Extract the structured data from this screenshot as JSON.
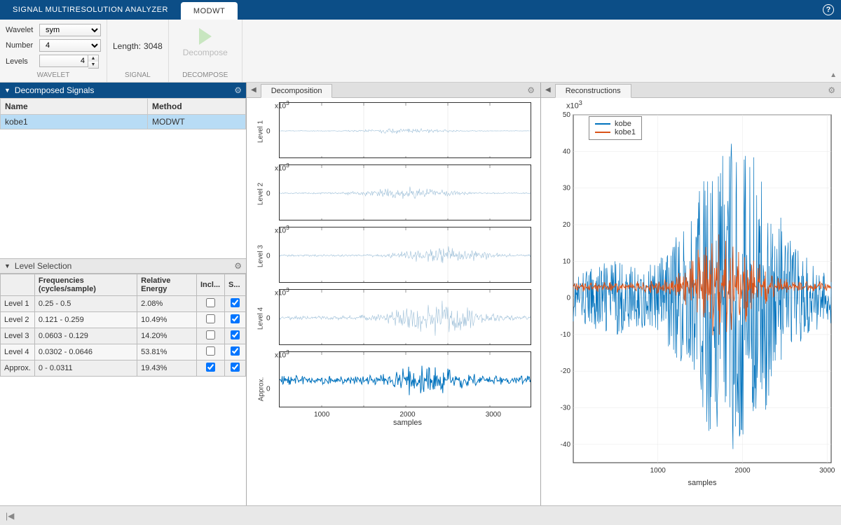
{
  "titlebar": {
    "app_title": "SIGNAL MULTIRESOLUTION ANALYZER",
    "active_tab": "MODWT"
  },
  "toolstrip": {
    "wavelet": {
      "label": "Wavelet",
      "value": "sym",
      "group": "WAVELET"
    },
    "number": {
      "label": "Number",
      "value": "4"
    },
    "levels": {
      "label": "Levels",
      "value": "4"
    },
    "signal": {
      "length_label": "Length:",
      "length_value": "3048",
      "group": "SIGNAL"
    },
    "decompose": {
      "label": "Decompose",
      "group": "DECOMPOSE"
    }
  },
  "decomposed_signals": {
    "title": "Decomposed Signals",
    "columns": [
      "Name",
      "Method"
    ],
    "rows": [
      {
        "name": "kobe1",
        "method": "MODWT"
      }
    ]
  },
  "level_selection": {
    "title": "Level Selection",
    "columns": [
      "",
      "Frequencies (cycles/sample)",
      "Relative Energy",
      "Incl...",
      "S..."
    ],
    "rows": [
      {
        "level": "Level 1",
        "freq": "0.25 - 0.5",
        "energy": "2.08%",
        "include": false,
        "show": true
      },
      {
        "level": "Level 2",
        "freq": "0.121 - 0.259",
        "energy": "10.49%",
        "include": false,
        "show": true
      },
      {
        "level": "Level 3",
        "freq": "0.0603 - 0.129",
        "energy": "14.20%",
        "include": false,
        "show": true
      },
      {
        "level": "Level 4",
        "freq": "0.0302 - 0.0646",
        "energy": "53.81%",
        "include": false,
        "show": true
      },
      {
        "level": "Approx.",
        "freq": "0 - 0.0311",
        "energy": "19.43%",
        "include": true,
        "show": true
      }
    ]
  },
  "decomposition_panel": {
    "tab": "Decomposition",
    "exp": "x10",
    "exp_sup": "3",
    "labels": [
      "Level 1",
      "Level 2",
      "Level 3",
      "Level 4",
      "Approx."
    ],
    "zero": "0",
    "xticks": [
      "1000",
      "2000",
      "3000"
    ],
    "xlabel": "samples"
  },
  "reconstructions_panel": {
    "tab": "Reconstructions",
    "exp": "x10",
    "exp_sup": "3",
    "legend": [
      "kobe",
      "kobe1"
    ],
    "colors": {
      "kobe": "#0072bd",
      "kobe1": "#d95319"
    },
    "yticks": [
      "50",
      "40",
      "30",
      "20",
      "10",
      "0",
      "-10",
      "-20",
      "-30",
      "-40"
    ],
    "xticks": [
      "1000",
      "2000",
      "3000"
    ],
    "xlabel": "samples"
  },
  "chart_data": [
    {
      "type": "line",
      "title": "Level 1",
      "xlabel": "samples",
      "ylabel": "x10^3",
      "x_range": [
        0,
        3048
      ],
      "y_range": [
        -1,
        1
      ],
      "note": "low-amplitude noise band"
    },
    {
      "type": "line",
      "title": "Level 2",
      "xlabel": "samples",
      "ylabel": "x10^3",
      "x_range": [
        0,
        3048
      ],
      "y_range": [
        -2,
        2
      ],
      "note": "noise band, slightly larger amplitude"
    },
    {
      "type": "line",
      "title": "Level 3",
      "xlabel": "samples",
      "ylabel": "x10^3",
      "x_range": [
        0,
        3048
      ],
      "y_range": [
        -3,
        3
      ],
      "note": "burst amplitude increases past ~1800"
    },
    {
      "type": "line",
      "title": "Level 4",
      "xlabel": "samples",
      "ylabel": "x10^3",
      "x_range": [
        0,
        3048
      ],
      "y_range": [
        -5,
        5
      ],
      "note": "dominant energy, large burst 1700-2200"
    },
    {
      "type": "line",
      "title": "Approx.",
      "xlabel": "samples",
      "ylabel": "x10^3",
      "x_range": [
        0,
        3048
      ],
      "y_range": [
        -3,
        3
      ],
      "note": "low-freq approximation, oscillation near 1700-2000"
    },
    {
      "type": "line",
      "title": "Reconstructions",
      "xlabel": "samples",
      "ylabel": "x10^3",
      "x_range": [
        0,
        3048
      ],
      "y_range": [
        -40,
        50
      ],
      "series": [
        {
          "name": "kobe",
          "color": "#0072bd",
          "note": "original seismic signal, peak amplitude ~±40 near x≈1900"
        },
        {
          "name": "kobe1",
          "color": "#d95319",
          "note": "reconstruction (approx only), peak amplitude ~±15 near x≈1800"
        }
      ]
    }
  ]
}
